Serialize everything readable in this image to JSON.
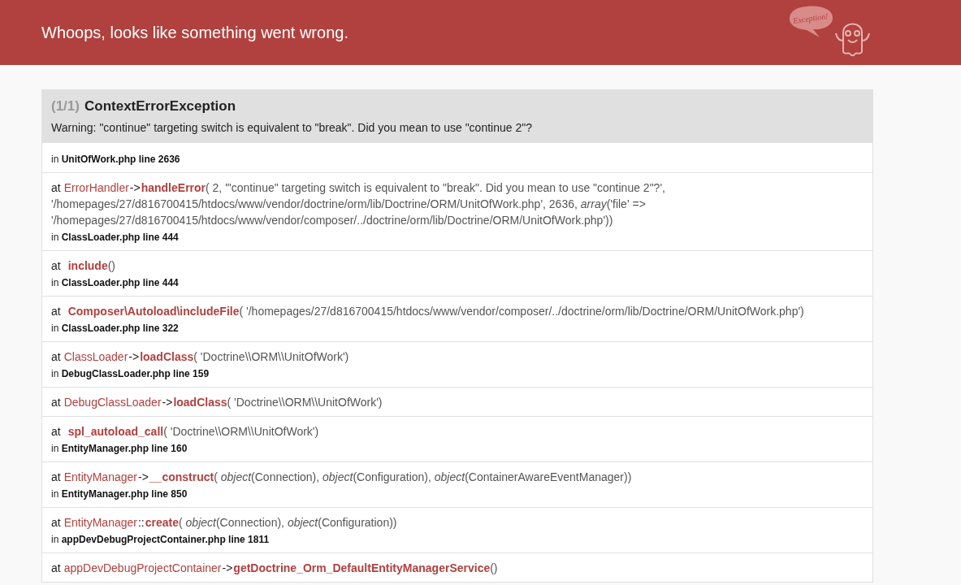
{
  "header": {
    "title": "Whoops, looks like something went wrong.",
    "logo_bubble": "Exception!"
  },
  "exception": {
    "counter": "(1/1)",
    "name": "ContextErrorException",
    "message": "Warning: \"continue\" targeting switch is equivalent to \"break\". Did you mean to use \"continue 2\"?"
  },
  "trace": [
    {
      "kind": "origin",
      "location": "in **UnitOfWork.php line 2636**"
    },
    {
      "kind": "frame",
      "prefix": "at",
      "class": "ErrorHandler",
      "separator": "->",
      "function": "handleError",
      "args": "( 2, '\"continue\" targeting switch is equivalent to \"break\". Did you mean to use \"continue 2\"?', '/homepages/27/d816700415/htdocs/www/vendor/doctrine/orm/lib/Doctrine/ORM/UnitOfWork.php', 2636, *array*('file' => '/homepages/27/d816700415/htdocs/www/vendor/composer/../doctrine/orm/lib/Doctrine/ORM/UnitOfWork.php'))",
      "location": "in **ClassLoader.php line 444**"
    },
    {
      "kind": "frame",
      "prefix": "at",
      "function": "include",
      "args": "()",
      "location": "in **ClassLoader.php line 444**"
    },
    {
      "kind": "frame",
      "prefix": "at",
      "function": "Composer\\Autoload\\includeFile",
      "args": "( '/homepages/27/d816700415/htdocs/www/vendor/composer/../doctrine/orm/lib/Doctrine/ORM/UnitOfWork.php')",
      "location": "in **ClassLoader.php line 322**"
    },
    {
      "kind": "frame",
      "prefix": "at",
      "class": "ClassLoader",
      "separator": "->",
      "function": "loadClass",
      "args": "( 'Doctrine\\\\ORM\\\\UnitOfWork')",
      "location": "in **DebugClassLoader.php line 159**"
    },
    {
      "kind": "frame",
      "prefix": "at",
      "class": "DebugClassLoader",
      "separator": "->",
      "function": "loadClass",
      "args": "( 'Doctrine\\\\ORM\\\\UnitOfWork')"
    },
    {
      "kind": "frame",
      "prefix": "at",
      "function": "spl_autoload_call",
      "args": "( 'Doctrine\\\\ORM\\\\UnitOfWork')",
      "location": "in **EntityManager.php line 160**"
    },
    {
      "kind": "frame",
      "prefix": "at",
      "class": "EntityManager",
      "separator": "->",
      "function": "__construct",
      "args": "( *object*(Connection), *object*(Configuration), *object*(ContainerAwareEventManager))",
      "location": "in **EntityManager.php line 850**"
    },
    {
      "kind": "frame",
      "prefix": "at",
      "class": "EntityManager",
      "separator": "::",
      "function": "create",
      "args": "( *object*(Connection), *object*(Configuration))",
      "location": "in **appDevDebugProjectContainer.php line 1811**"
    },
    {
      "kind": "frame",
      "prefix": "at",
      "class": "appDevDebugProjectContainer",
      "separator": "->",
      "function": "getDoctrine_Orm_DefaultEntityManagerService",
      "args": "()"
    }
  ]
}
